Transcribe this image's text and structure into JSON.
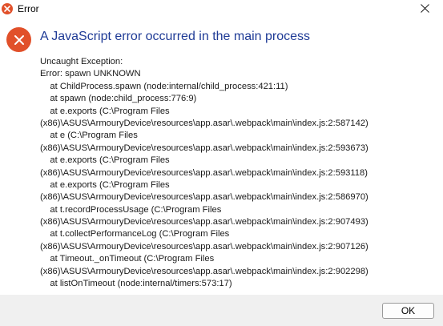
{
  "window": {
    "title": "Error",
    "icon": "error-x-icon",
    "close_icon": "close-icon"
  },
  "dialog": {
    "heading": "A JavaScript error occurred in the main process",
    "icon": "error-x-icon",
    "accent_color": "#e1502a",
    "heading_color": "#1f3b96",
    "message_lines": [
      "Uncaught Exception:",
      "Error: spawn UNKNOWN",
      "    at ChildProcess.spawn (node:internal/child_process:421:11)",
      "    at spawn (node:child_process:776:9)",
      "    at e.exports (C:\\Program Files",
      "(x86)\\ASUS\\ArmouryDevice\\resources\\app.asar\\.webpack\\main\\index.js:2:587142)",
      "    at e (C:\\Program Files",
      "(x86)\\ASUS\\ArmouryDevice\\resources\\app.asar\\.webpack\\main\\index.js:2:593673)",
      "    at e.exports (C:\\Program Files",
      "(x86)\\ASUS\\ArmouryDevice\\resources\\app.asar\\.webpack\\main\\index.js:2:593118)",
      "    at e.exports (C:\\Program Files",
      "(x86)\\ASUS\\ArmouryDevice\\resources\\app.asar\\.webpack\\main\\index.js:2:586970)",
      "    at t.recordProcessUsage (C:\\Program Files",
      "(x86)\\ASUS\\ArmouryDevice\\resources\\app.asar\\.webpack\\main\\index.js:2:907493)",
      "    at t.collectPerformanceLog (C:\\Program Files",
      "(x86)\\ASUS\\ArmouryDevice\\resources\\app.asar\\.webpack\\main\\index.js:2:907126)",
      "    at Timeout._onTimeout (C:\\Program Files",
      "(x86)\\ASUS\\ArmouryDevice\\resources\\app.asar\\.webpack\\main\\index.js:2:902298)",
      "    at listOnTimeout (node:internal/timers:573:17)"
    ]
  },
  "footer": {
    "ok_label": "OK"
  }
}
